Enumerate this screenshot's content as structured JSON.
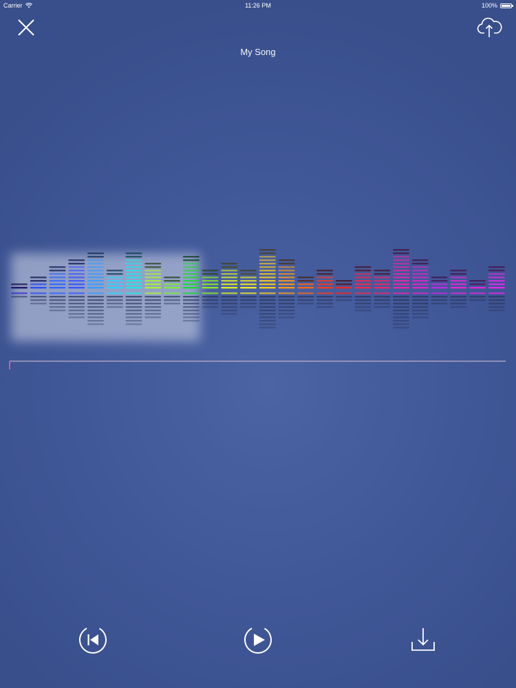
{
  "status_bar": {
    "carrier": "Carrier",
    "time": "11:26 PM",
    "battery": "100%"
  },
  "header": {
    "title": "My Song",
    "close_icon": "close-icon",
    "upload_icon": "cloud-upload-icon"
  },
  "equalizer": {
    "bar_levels": [
      2,
      4,
      7,
      9,
      11,
      6,
      11,
      8,
      4,
      10,
      6,
      8,
      6,
      12,
      9,
      4,
      6,
      3,
      7,
      6,
      12,
      9,
      4,
      6,
      3,
      7
    ],
    "reflection_levels": [
      2,
      4,
      6,
      8,
      10,
      5,
      10,
      8,
      4,
      9,
      5,
      7,
      5,
      11,
      8,
      4,
      5,
      3,
      6,
      5,
      11,
      8,
      4,
      5,
      3,
      6
    ],
    "colors": [
      "#3b2fcf",
      "#2f4ef2",
      "#2f66ff",
      "#3a55ff",
      "#3b9bff",
      "#2fd0ff",
      "#22e4e8",
      "#a8f03a",
      "#7ee83a",
      "#22d43a",
      "#8ee62c",
      "#dcea2a",
      "#f2e62a",
      "#f6c928",
      "#f59a22",
      "#f5661f",
      "#f23a22",
      "#ef2626",
      "#ee2a4f",
      "#e22a6e",
      "#e12aa6",
      "#d72ac6",
      "#c22ae0",
      "#e22ad2",
      "#d92ad9",
      "#e02ae6"
    ],
    "selection_highlight": "#d7dcec",
    "progress_line_color": "#e0c8d8",
    "progress_marker_color": "#ff5ca5"
  },
  "controls": {
    "previous_icon": "skip-previous-icon",
    "play_icon": "play-icon",
    "download_icon": "download-icon"
  }
}
